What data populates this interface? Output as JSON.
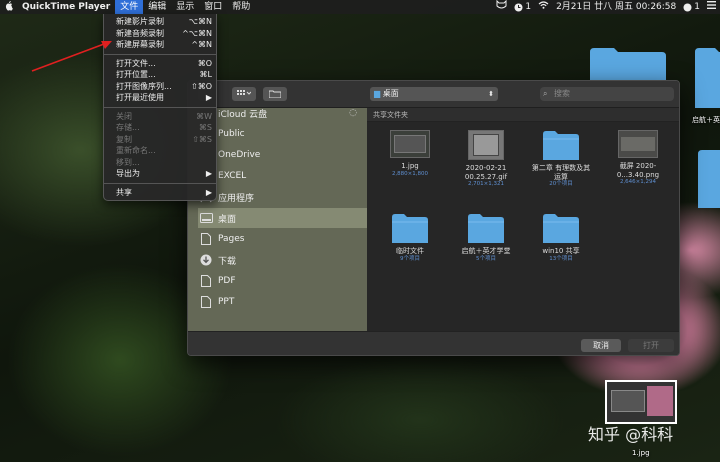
{
  "menubar": {
    "apple": "",
    "app_name": "QuickTime Player",
    "menus": [
      "文件",
      "编辑",
      "显示",
      "窗口",
      "帮助"
    ],
    "status_badge": "1",
    "datetime": "2月21日 廿八 周五 00:26:58",
    "notif_count": "1"
  },
  "file_menu": {
    "group1": [
      {
        "label": "新建影片录制",
        "shortcut": "⌥⌘N"
      },
      {
        "label": "新建音频录制",
        "shortcut": "^⌥⌘N"
      },
      {
        "label": "新建屏幕录制",
        "shortcut": "^⌘N"
      }
    ],
    "group2": [
      {
        "label": "打开文件...",
        "shortcut": "⌘O"
      },
      {
        "label": "打开位置...",
        "shortcut": "⌘L"
      },
      {
        "label": "打开图像序列...",
        "shortcut": "⇧⌘O"
      },
      {
        "label": "打开最近使用",
        "shortcut": "▶"
      }
    ],
    "group3": [
      {
        "label": "关闭",
        "shortcut": "⌘W",
        "disabled": true
      },
      {
        "label": "存储...",
        "shortcut": "⌘S",
        "disabled": true
      },
      {
        "label": "复制",
        "shortcut": "⇧⌘S",
        "disabled": true
      },
      {
        "label": "重新命名...",
        "shortcut": "",
        "disabled": true
      },
      {
        "label": "移到...",
        "shortcut": "",
        "disabled": true
      },
      {
        "label": "导出为",
        "shortcut": "▶",
        "disabled": false
      }
    ],
    "group4": [
      {
        "label": "共享",
        "shortcut": "▶"
      }
    ]
  },
  "dialog": {
    "location": "桌面",
    "search_placeholder": "搜索",
    "section_header": "共享文件夹",
    "sidebar": [
      {
        "label": "iCloud 云盘",
        "icon": "cloud-icon"
      },
      {
        "label": "Public",
        "icon": "folder-icon"
      },
      {
        "label": "OneDrive",
        "icon": "folder-icon"
      },
      {
        "label": "EXCEL",
        "icon": "folder-icon"
      },
      {
        "label": "应用程序",
        "icon": "apps-icon"
      },
      {
        "label": "桌面",
        "icon": "desktop-icon"
      },
      {
        "label": "Pages",
        "icon": "document-icon"
      },
      {
        "label": "下载",
        "icon": "download-icon"
      },
      {
        "label": "PDF",
        "icon": "document-icon"
      },
      {
        "label": "PPT",
        "icon": "document-icon"
      }
    ],
    "items": [
      {
        "name": "1.jpg",
        "sub": "2,880×1,800",
        "kind": "image"
      },
      {
        "name": "2020-02-21 00.25.27.gif",
        "sub": "2,701×1,321",
        "kind": "image"
      },
      {
        "name": "第二章 有理数及其运算",
        "sub": "20个项目",
        "kind": "folder"
      },
      {
        "name": "截屏 2020-0...3.40.png",
        "sub": "2,646×1,294",
        "kind": "image"
      },
      {
        "name": "临时文件",
        "sub": "9个项目",
        "kind": "folder"
      },
      {
        "name": "启航＋英才学堂",
        "sub": "5个项目",
        "kind": "folder"
      },
      {
        "name": "win10 共享",
        "sub": "13个项目",
        "kind": "folder"
      }
    ],
    "cancel_label": "取消",
    "open_label": "打开"
  },
  "desktop": {
    "label_right": "启航＋英",
    "thumb_label": "1.jpg",
    "watermark": "知乎 @科科"
  },
  "colors": {
    "accent": "#2f6fd8",
    "folder": "#5aa7e0",
    "arrow": "#e02020"
  }
}
